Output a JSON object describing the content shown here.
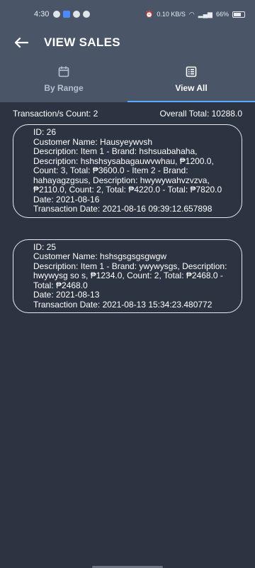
{
  "status": {
    "time": "4:30",
    "signal_text": "0.10 KB/S",
    "battery": "66%"
  },
  "header": {
    "title": "VIEW SALES"
  },
  "tabs": [
    {
      "label": "By Range",
      "icon": "calendar-icon",
      "active": false
    },
    {
      "label": "View All",
      "icon": "list-icon",
      "active": true
    }
  ],
  "summary": {
    "count_text": "Transaction/s Count: 2",
    "total_text": "Overall Total: 10288.0"
  },
  "transactions": [
    {
      "id": "ID: 26",
      "customer": "Customer Name: Hausyeywvsh",
      "description": "Description: Item 1 - Brand: hshsuabahaha, Description: hshshsysabagauwvwhau, ₱1200.0, Count: 3, Total: ₱3600.0 - Item 2 - Brand: hahayagzgsus, Description: hwywywahvzvzva, ₱2110.0, Count: 2, Total: ₱4220.0 - Total: ₱7820.0",
      "date": "Date: 2021-08-16",
      "transaction_date": "Transaction Date: 2021-08-16 09:39:12.657898"
    },
    {
      "id": "ID: 25",
      "customer": "Customer Name: hshsgsgsgsgwgw",
      "description": "Description: Item 1 - Brand: ywywysgs, Description: hwywysg so s, ₱1234.0, Count: 2, Total: ₱2468.0 - Total: ₱2468.0",
      "date": "Date: 2021-08-13",
      "transaction_date": "Transaction Date: 2021-08-13 15:34:23.480772"
    }
  ],
  "colors": {
    "background": "#2d3441",
    "appbar": "#4a5568",
    "accent": "#5aa9ff"
  }
}
